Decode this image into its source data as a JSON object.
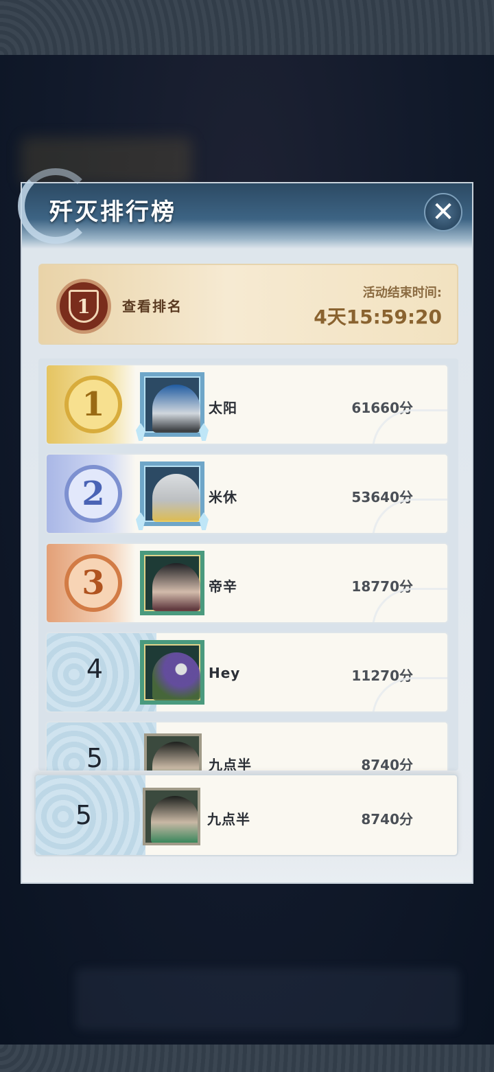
{
  "dialog": {
    "title": "歼灭排行榜",
    "close_icon": "close-icon"
  },
  "my_rank_card": {
    "badge_text": "1",
    "view_rank_label": "查看排名",
    "end_time_label": "活动结束时间:",
    "end_time_value": "4天15:59:20"
  },
  "leaderboard": {
    "rows": [
      {
        "rank": "1",
        "medal": "gold-medal-icon",
        "name": "太阳",
        "score": "61660分"
      },
      {
        "rank": "2",
        "medal": "silver-medal-icon",
        "name": "米休",
        "score": "53640分"
      },
      {
        "rank": "3",
        "medal": "bronze-medal-icon",
        "name": "帝辛",
        "score": "18770分"
      },
      {
        "rank": "4",
        "name": "Hey",
        "score": "11270分"
      },
      {
        "rank": "5",
        "name": "九点半",
        "score": "8740分"
      }
    ]
  },
  "self_row": {
    "rank": "5",
    "name": "九点半",
    "score": "8740分"
  },
  "colors": {
    "gold": "#d8ac3c",
    "silver": "#7d90d0",
    "bronze": "#d27b45",
    "header": "#2c4a64"
  }
}
